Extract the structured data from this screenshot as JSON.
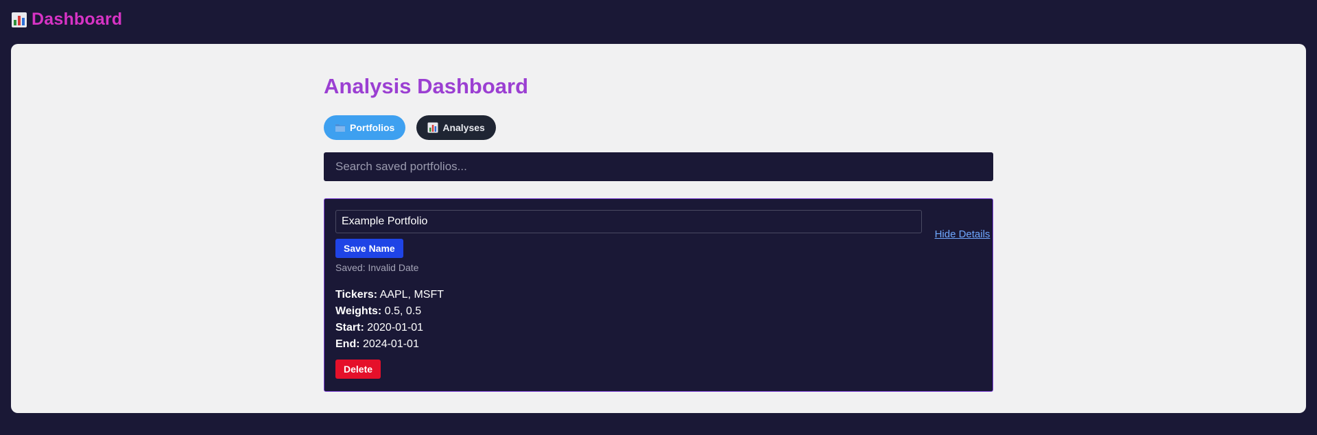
{
  "header": {
    "icon": "bar-chart-icon",
    "title": "Dashboard"
  },
  "main": {
    "page_title": "Analysis Dashboard",
    "tabs": [
      {
        "label": "Portfolios",
        "icon": "folder-icon",
        "active": true
      },
      {
        "label": "Analyses",
        "icon": "bar-chart-icon",
        "active": false
      }
    ],
    "search": {
      "placeholder": "Search saved portfolios...",
      "value": ""
    },
    "portfolio": {
      "name": "Example Portfolio",
      "save_label": "Save Name",
      "saved_text": "Saved: Invalid Date",
      "toggle_label": "Hide Details",
      "details": [
        {
          "key": "Tickers:",
          "value": "AAPL, MSFT"
        },
        {
          "key": "Weights:",
          "value": "0.5, 0.5"
        },
        {
          "key": "Start:",
          "value": "2020-01-01"
        },
        {
          "key": "End:",
          "value": "2024-01-01"
        }
      ],
      "delete_label": "Delete"
    }
  },
  "colors": {
    "background": "#1a1836",
    "brand": "#d633c4",
    "title": "#9b3fd2",
    "tab_active": "#3ea0f0",
    "tab_inactive": "#1f2533",
    "save_button": "#1f44e6",
    "delete_button": "#e5102a",
    "card_border": "#7a3fd6",
    "link": "#6fa8ff"
  }
}
